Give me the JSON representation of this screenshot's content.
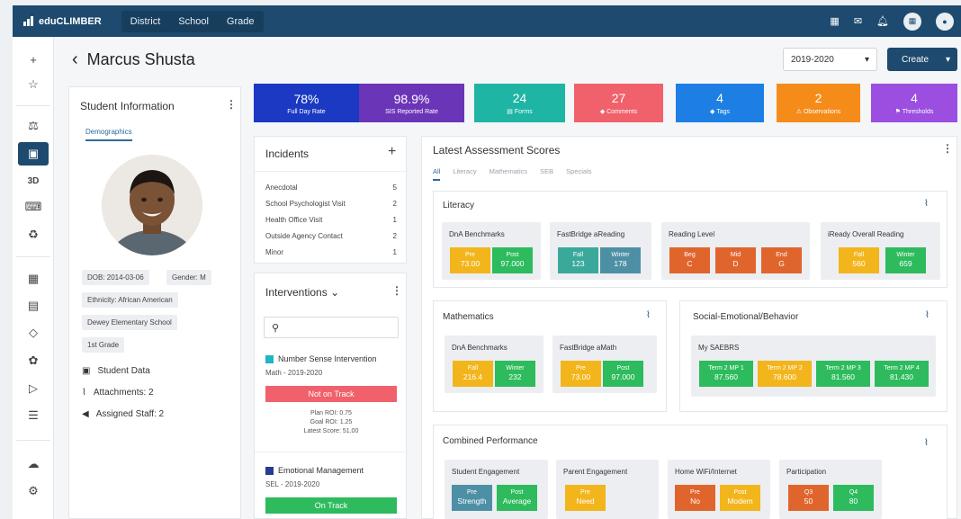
{
  "app": {
    "brand": "eduCLIMBER",
    "topnav": [
      "District",
      "School",
      "Grade"
    ],
    "top_icons": [
      "calendar-icon",
      "mail-icon",
      "bell-icon",
      "grid-icon",
      "user-icon"
    ]
  },
  "rail": {
    "top": [
      "plus-icon",
      "star-icon"
    ],
    "middle": [
      "analytics-icon",
      "student-card-icon",
      "3d-icon",
      "keyboard-icon",
      "recycle-icon"
    ],
    "lower": [
      "calendar-icon",
      "clipboard-icon",
      "tag-icon",
      "group-icon",
      "flag-icon",
      "list-icon"
    ],
    "bottom": [
      "cloud-icon",
      "gear-icon"
    ],
    "active_label": "student-card-icon",
    "text_3d": "3D"
  },
  "header": {
    "student_name": "Marcus Shusta",
    "year": "2019-2020",
    "create_label": "Create"
  },
  "student_info": {
    "title": "Student Information",
    "tab": "Demographics",
    "dob": "DOB: 2014-03-06",
    "gender": "Gender: M",
    "ethnicity": "Ethnicity: African American",
    "school": "Dewey Elementary School",
    "grade": "1st Grade",
    "links": [
      "Student Data",
      "Attachments: 2",
      "Assigned Staff: 2"
    ]
  },
  "kpis": [
    {
      "value": "78%",
      "label": "Full Day Rate",
      "color": "#1b39c2"
    },
    {
      "value": "98.9%",
      "label": "SIS Reported Rate",
      "color": "#6b35b8"
    },
    {
      "value": "24",
      "label": "Forms",
      "color": "#1fb5a4"
    },
    {
      "value": "27",
      "label": "Comments",
      "color": "#f0616b"
    },
    {
      "value": "4",
      "label": "Tags",
      "color": "#1d7fe3"
    },
    {
      "value": "2",
      "label": "Observations",
      "color": "#f58c1a"
    },
    {
      "value": "4",
      "label": "Thresholds",
      "color": "#9b4ee0"
    }
  ],
  "incidents": {
    "title": "Incidents",
    "rows": [
      {
        "label": "Anecdotal",
        "count": "5"
      },
      {
        "label": "School Psychologist Visit",
        "count": "2"
      },
      {
        "label": "Health Office Visit",
        "count": "1"
      },
      {
        "label": "Outside Agency Contact",
        "count": "2"
      },
      {
        "label": "Minor",
        "count": "1"
      }
    ]
  },
  "interventions": {
    "title": "Interventions",
    "search_placeholder": "",
    "items": [
      {
        "name": "Number Sense Intervention",
        "sub": "Math - 2019-2020",
        "status": "Not on Track",
        "status_color": "#f0616b",
        "stats": [
          "Plan ROI: 0.75",
          "Goal ROI: 1.25",
          "Latest Score: 51.00"
        ],
        "swatch": "#1fb5c4"
      },
      {
        "name": "Emotional Management",
        "sub": "SEL - 2019-2020",
        "status": "On Track",
        "status_color": "#2dbb5d",
        "swatch": "#2b3b8f"
      }
    ]
  },
  "latest": {
    "title": "Latest Assessment Scores",
    "tabs": [
      "All",
      "Literacy",
      "Mathematics",
      "SEB",
      "Specials"
    ],
    "literacy": {
      "title": "Literacy",
      "groups": [
        {
          "title": "DnA Benchmarks",
          "chips": [
            {
              "label": "Pre",
              "value": "73.00",
              "color": "#f3b51c"
            },
            {
              "label": "Post",
              "value": "97.000",
              "color": "#2dbb5d"
            }
          ]
        },
        {
          "title": "FastBridge aReading",
          "chips": [
            {
              "label": "Fall",
              "value": "123",
              "color": "#3aa99c"
            },
            {
              "label": "Winter",
              "value": "178",
              "color": "#4d90a6"
            }
          ]
        },
        {
          "title": "Reading Level",
          "chips": [
            {
              "label": "Beg",
              "value": "C",
              "color": "#e0652c"
            },
            {
              "label": "Mid",
              "value": "D",
              "color": "#e0652c"
            },
            {
              "label": "End",
              "value": "G",
              "color": "#e0652c"
            }
          ]
        },
        {
          "title": "iReady Overall Reading",
          "chips": [
            {
              "label": "Fall",
              "value": "560",
              "color": "#f3b51c"
            },
            {
              "label": "Winter",
              "value": "659",
              "color": "#2dbb5d"
            }
          ]
        }
      ]
    },
    "mathematics": {
      "title": "Mathematics",
      "groups": [
        {
          "title": "DnA Benchmarks",
          "chips": [
            {
              "label": "Fall",
              "value": "216.4",
              "color": "#f3b51c"
            },
            {
              "label": "Winter",
              "value": "232",
              "color": "#2dbb5d"
            }
          ]
        },
        {
          "title": "FastBridge aMath",
          "chips": [
            {
              "label": "Pre",
              "value": "73.00",
              "color": "#f3b51c"
            },
            {
              "label": "Post",
              "value": "97.000",
              "color": "#2dbb5d"
            }
          ]
        }
      ]
    },
    "seb": {
      "title": "Social-Emotional/Behavior",
      "groups": [
        {
          "title": "My SAEBRS",
          "chips": [
            {
              "label": "Term 2 MP 1",
              "value": "87.560",
              "color": "#2dbb5d"
            },
            {
              "label": "Term 2 MP 2",
              "value": "78.600",
              "color": "#f3b51c"
            },
            {
              "label": "Term 2 MP 3",
              "value": "81.560",
              "color": "#2dbb5d"
            },
            {
              "label": "Term 2 MP 4",
              "value": "81.430",
              "color": "#2dbb5d"
            }
          ]
        }
      ]
    },
    "combined": {
      "title": "Combined Performance",
      "groups": [
        {
          "title": "Student Engagement",
          "chips": [
            {
              "label": "Pre",
              "value": "Strength",
              "color": "#4d90a6"
            },
            {
              "label": "Post",
              "value": "Average",
              "color": "#2dbb5d"
            }
          ]
        },
        {
          "title": "Parent Engagement",
          "chips": [
            {
              "label": "Pre",
              "value": "Need",
              "color": "#f3b51c"
            }
          ]
        },
        {
          "title": "Home WiFi/Internet",
          "chips": [
            {
              "label": "Pre",
              "value": "No",
              "color": "#e0652c"
            },
            {
              "label": "Post",
              "value": "Modem",
              "color": "#f3b51c"
            }
          ]
        },
        {
          "title": "Participation",
          "chips": [
            {
              "label": "Q3",
              "value": "50",
              "color": "#e0652c"
            },
            {
              "label": "Q4",
              "value": "80",
              "color": "#2dbb5d"
            }
          ]
        }
      ]
    }
  }
}
